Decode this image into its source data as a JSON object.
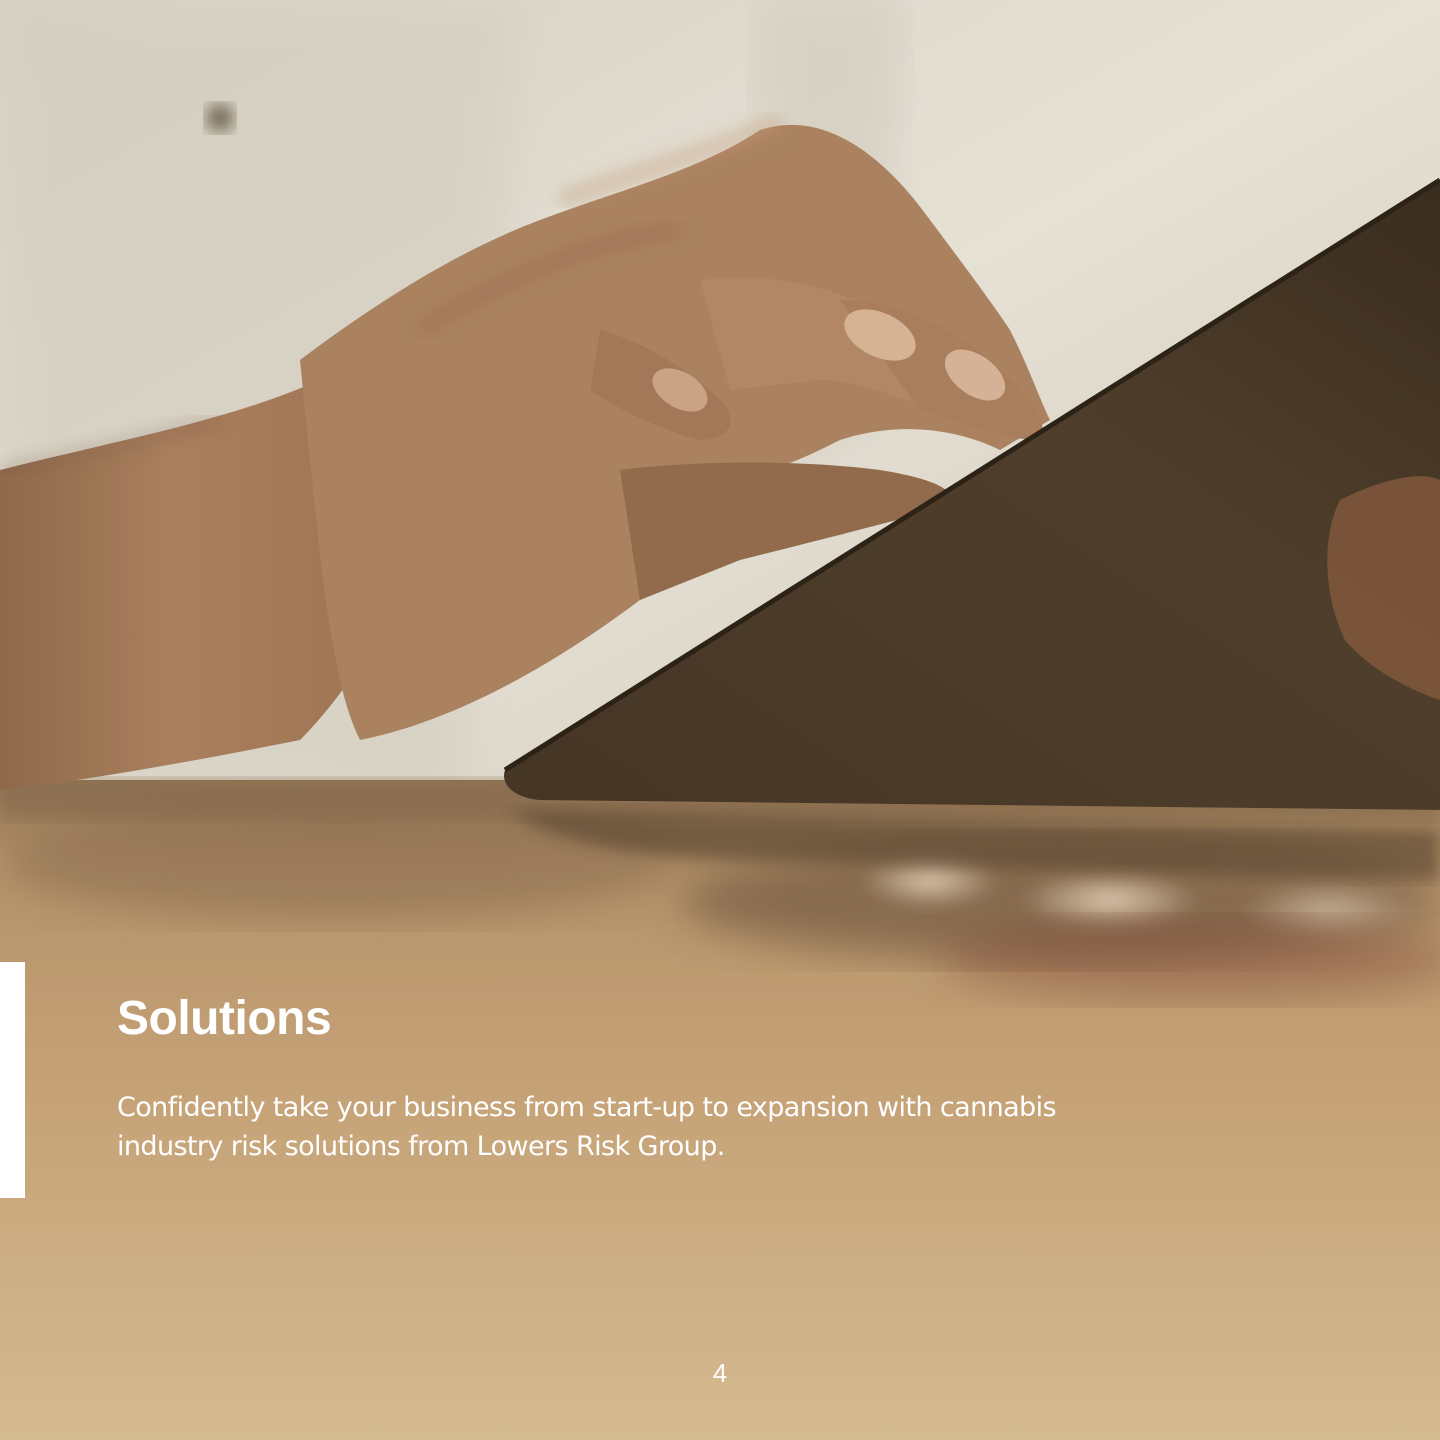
{
  "photo": {
    "description_icon": "hand-on-tablet-photo",
    "colors": {
      "shirt": "#e4e1d8",
      "skin": "#a27a5a",
      "tablet": "#3f3123",
      "table": "#c29f72"
    }
  },
  "section": {
    "heading": "Solutions",
    "body": "Confidently take your business from start-up to expansion with cannabis industry risk solutions from Lowers Risk Group."
  },
  "footer": {
    "page_number": "4"
  },
  "colors": {
    "accent_bar": "#ffffff",
    "text": "#ffffff"
  }
}
